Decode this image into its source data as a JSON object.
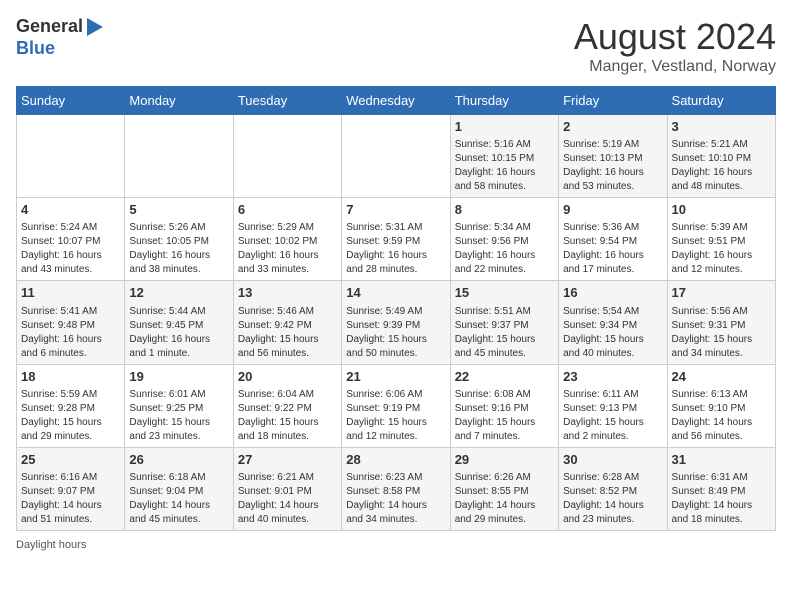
{
  "header": {
    "logo_line1": "General",
    "logo_line2": "Blue",
    "title": "August 2024",
    "subtitle": "Manger, Vestland, Norway"
  },
  "days_of_week": [
    "Sunday",
    "Monday",
    "Tuesday",
    "Wednesday",
    "Thursday",
    "Friday",
    "Saturday"
  ],
  "weeks": [
    [
      {
        "day": "",
        "info": ""
      },
      {
        "day": "",
        "info": ""
      },
      {
        "day": "",
        "info": ""
      },
      {
        "day": "",
        "info": ""
      },
      {
        "day": "1",
        "info": "Sunrise: 5:16 AM\nSunset: 10:15 PM\nDaylight: 16 hours\nand 58 minutes."
      },
      {
        "day": "2",
        "info": "Sunrise: 5:19 AM\nSunset: 10:13 PM\nDaylight: 16 hours\nand 53 minutes."
      },
      {
        "day": "3",
        "info": "Sunrise: 5:21 AM\nSunset: 10:10 PM\nDaylight: 16 hours\nand 48 minutes."
      }
    ],
    [
      {
        "day": "4",
        "info": "Sunrise: 5:24 AM\nSunset: 10:07 PM\nDaylight: 16 hours\nand 43 minutes."
      },
      {
        "day": "5",
        "info": "Sunrise: 5:26 AM\nSunset: 10:05 PM\nDaylight: 16 hours\nand 38 minutes."
      },
      {
        "day": "6",
        "info": "Sunrise: 5:29 AM\nSunset: 10:02 PM\nDaylight: 16 hours\nand 33 minutes."
      },
      {
        "day": "7",
        "info": "Sunrise: 5:31 AM\nSunset: 9:59 PM\nDaylight: 16 hours\nand 28 minutes."
      },
      {
        "day": "8",
        "info": "Sunrise: 5:34 AM\nSunset: 9:56 PM\nDaylight: 16 hours\nand 22 minutes."
      },
      {
        "day": "9",
        "info": "Sunrise: 5:36 AM\nSunset: 9:54 PM\nDaylight: 16 hours\nand 17 minutes."
      },
      {
        "day": "10",
        "info": "Sunrise: 5:39 AM\nSunset: 9:51 PM\nDaylight: 16 hours\nand 12 minutes."
      }
    ],
    [
      {
        "day": "11",
        "info": "Sunrise: 5:41 AM\nSunset: 9:48 PM\nDaylight: 16 hours\nand 6 minutes."
      },
      {
        "day": "12",
        "info": "Sunrise: 5:44 AM\nSunset: 9:45 PM\nDaylight: 16 hours\nand 1 minute."
      },
      {
        "day": "13",
        "info": "Sunrise: 5:46 AM\nSunset: 9:42 PM\nDaylight: 15 hours\nand 56 minutes."
      },
      {
        "day": "14",
        "info": "Sunrise: 5:49 AM\nSunset: 9:39 PM\nDaylight: 15 hours\nand 50 minutes."
      },
      {
        "day": "15",
        "info": "Sunrise: 5:51 AM\nSunset: 9:37 PM\nDaylight: 15 hours\nand 45 minutes."
      },
      {
        "day": "16",
        "info": "Sunrise: 5:54 AM\nSunset: 9:34 PM\nDaylight: 15 hours\nand 40 minutes."
      },
      {
        "day": "17",
        "info": "Sunrise: 5:56 AM\nSunset: 9:31 PM\nDaylight: 15 hours\nand 34 minutes."
      }
    ],
    [
      {
        "day": "18",
        "info": "Sunrise: 5:59 AM\nSunset: 9:28 PM\nDaylight: 15 hours\nand 29 minutes."
      },
      {
        "day": "19",
        "info": "Sunrise: 6:01 AM\nSunset: 9:25 PM\nDaylight: 15 hours\nand 23 minutes."
      },
      {
        "day": "20",
        "info": "Sunrise: 6:04 AM\nSunset: 9:22 PM\nDaylight: 15 hours\nand 18 minutes."
      },
      {
        "day": "21",
        "info": "Sunrise: 6:06 AM\nSunset: 9:19 PM\nDaylight: 15 hours\nand 12 minutes."
      },
      {
        "day": "22",
        "info": "Sunrise: 6:08 AM\nSunset: 9:16 PM\nDaylight: 15 hours\nand 7 minutes."
      },
      {
        "day": "23",
        "info": "Sunrise: 6:11 AM\nSunset: 9:13 PM\nDaylight: 15 hours\nand 2 minutes."
      },
      {
        "day": "24",
        "info": "Sunrise: 6:13 AM\nSunset: 9:10 PM\nDaylight: 14 hours\nand 56 minutes."
      }
    ],
    [
      {
        "day": "25",
        "info": "Sunrise: 6:16 AM\nSunset: 9:07 PM\nDaylight: 14 hours\nand 51 minutes."
      },
      {
        "day": "26",
        "info": "Sunrise: 6:18 AM\nSunset: 9:04 PM\nDaylight: 14 hours\nand 45 minutes."
      },
      {
        "day": "27",
        "info": "Sunrise: 6:21 AM\nSunset: 9:01 PM\nDaylight: 14 hours\nand 40 minutes."
      },
      {
        "day": "28",
        "info": "Sunrise: 6:23 AM\nSunset: 8:58 PM\nDaylight: 14 hours\nand 34 minutes."
      },
      {
        "day": "29",
        "info": "Sunrise: 6:26 AM\nSunset: 8:55 PM\nDaylight: 14 hours\nand 29 minutes."
      },
      {
        "day": "30",
        "info": "Sunrise: 6:28 AM\nSunset: 8:52 PM\nDaylight: 14 hours\nand 23 minutes."
      },
      {
        "day": "31",
        "info": "Sunrise: 6:31 AM\nSunset: 8:49 PM\nDaylight: 14 hours\nand 18 minutes."
      }
    ]
  ],
  "legend": {
    "daylight_label": "Daylight hours"
  }
}
